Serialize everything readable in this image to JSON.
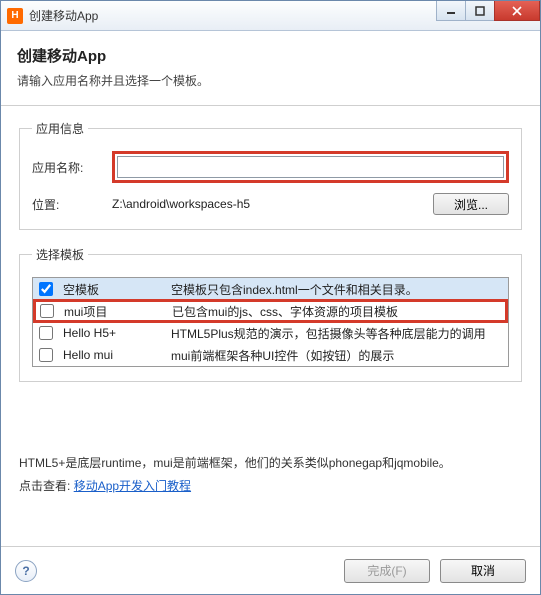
{
  "window": {
    "title": "创建移动App",
    "icon_letter": "H"
  },
  "header": {
    "title": "创建移动App",
    "subtitle": "请输入应用名称并且选择一个模板。"
  },
  "app_info": {
    "legend": "应用信息",
    "name_label": "应用名称:",
    "name_value": "",
    "location_label": "位置:",
    "location_value": "Z:\\android\\workspaces-h5",
    "browse_label": "浏览..."
  },
  "templates": {
    "legend": "选择模板",
    "rows": [
      {
        "name": "空模板",
        "desc": "空模板只包含index.html一个文件和相关目录。",
        "checked": true,
        "selected": true,
        "highlighted": false
      },
      {
        "name": "mui项目",
        "desc": "已包含mui的js、css、字体资源的项目模板",
        "checked": false,
        "selected": false,
        "highlighted": true
      },
      {
        "name": "Hello H5+",
        "desc": "HTML5Plus规范的演示，包括摄像头等各种底层能力的调用",
        "checked": false,
        "selected": false,
        "highlighted": false
      },
      {
        "name": "Hello mui",
        "desc": "mui前端框架各种UI控件（如按钮）的展示",
        "checked": false,
        "selected": false,
        "highlighted": false
      }
    ]
  },
  "note": {
    "line1": "HTML5+是底层runtime，mui是前端框架，他们的关系类似phonegap和jqmobile。",
    "line2_prefix": "点击查看:",
    "link_text": "移动App开发入门教程"
  },
  "footer": {
    "finish_label": "完成(F)",
    "cancel_label": "取消"
  }
}
